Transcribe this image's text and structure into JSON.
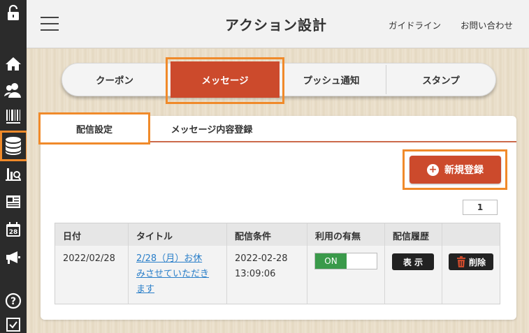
{
  "header": {
    "title": "アクション設計",
    "links": [
      "ガイドライン",
      "お問い合わせ"
    ]
  },
  "sidebar": {
    "icons": [
      "unlock-icon",
      "home-icon",
      "users-icon",
      "barcode-icon",
      "database-icon",
      "analytics-icon",
      "news-icon",
      "calendar-icon",
      "megaphone-icon",
      "help-icon",
      "checkbox-icon"
    ],
    "active": "database-icon",
    "calendar_day": "28"
  },
  "main_tabs": [
    "クーポン",
    "メッセージ",
    "プッシュ通知",
    "スタンプ"
  ],
  "main_tab_active": "メッセージ",
  "sub_tabs": [
    "配信設定",
    "メッセージ内容登録"
  ],
  "sub_tab_active": "配信設定",
  "actions": {
    "new_label": "新規登録"
  },
  "pagination": {
    "page": "1"
  },
  "table": {
    "headers": [
      "日付",
      "タイトル",
      "配信条件",
      "利用の有無",
      "配信履歴",
      ""
    ],
    "rows": [
      {
        "date": "2022/02/28",
        "title_lines": [
          "2/28（月）お休",
          "みさせていただき",
          "ます"
        ],
        "condition_lines": [
          "2022-02-28",
          "13:09:06"
        ],
        "status": "ON",
        "history_label": "表 示",
        "delete_label": "削除"
      }
    ]
  },
  "colors": {
    "accent": "#cc4a2c",
    "highlight": "#f08a2a",
    "on": "#3a9a4a",
    "link": "#2a7fc9"
  }
}
